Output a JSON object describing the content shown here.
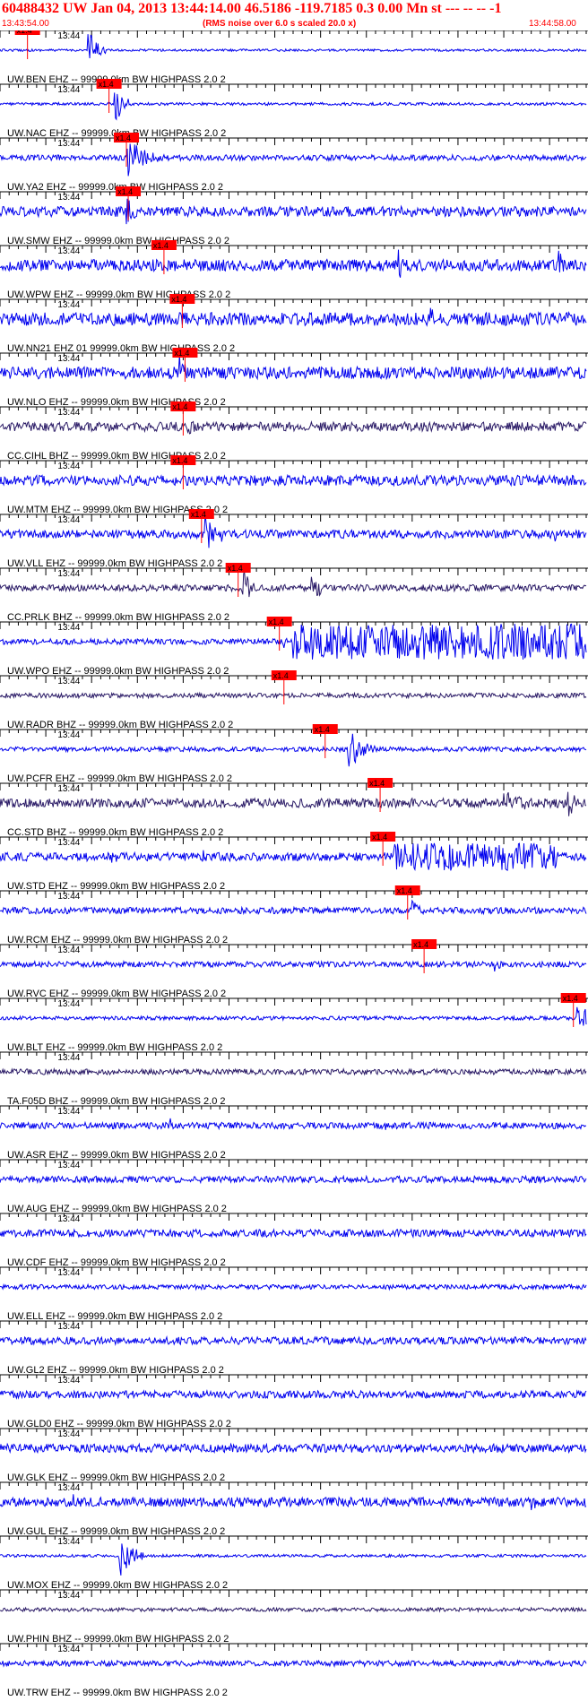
{
  "header": {
    "title": "60488432 UW Jan 04, 2013 13:44:14.00   46.5186 -119.7185  0.3 0.00 Mn st --- -- --   -1",
    "start_time": "13:43:54.00",
    "noise_note": "(RMS noise over 6.0 s scaled 20.0 x)",
    "end_time": "13:44:58.00"
  },
  "colors": {
    "header_red": "#ff0000",
    "trace_blue": "#0000ee",
    "trace_dark": "#2a1a66",
    "pick_red": "#ff0000",
    "axis": "#000000"
  },
  "chart_data": {
    "type": "line",
    "title": "60488432 UW Jan 04, 2013 13:44:14.00",
    "xlabel": "",
    "ylabel": "",
    "xlim": [
      "13:43:54.00",
      "13:44:58.00"
    ],
    "time_tick_label": "13:44",
    "pick_label": "x1.4",
    "traces": [
      {
        "label": "UW.BEN EHZ -- 99999.0km BW  HIGHPASS  2.0  2",
        "pick_s": 3.0,
        "amp": 0.05,
        "color": "blue",
        "events": [
          {
            "t": 9.6,
            "a": 0.95,
            "d": 2
          }
        ]
      },
      {
        "label": "UW.NAC EHZ -- 99999.0km BW  HIGHPASS  2.0  2",
        "pick_s": 11.9,
        "amp": 0.06,
        "color": "blue",
        "events": [
          {
            "t": 12.5,
            "a": 1.0,
            "d": 2
          }
        ]
      },
      {
        "label": "UW.YA2 EHZ -- 99999.0km BW  HIGHPASS  2.0  2",
        "pick_s": 13.8,
        "amp": 0.12,
        "color": "blue",
        "events": [
          {
            "t": 13.9,
            "a": 0.9,
            "d": 4
          }
        ]
      },
      {
        "label": "UW.SMW EHZ -- 99999.0km BW  HIGHPASS  2.0  2",
        "pick_s": 14.0,
        "amp": 0.22,
        "color": "blue",
        "events": [
          {
            "t": 13.8,
            "a": 0.6,
            "d": 3
          }
        ]
      },
      {
        "label": "UW.WPW EHZ -- 99999.0km BW  HIGHPASS  2.0  2",
        "pick_s": 17.9,
        "amp": 0.25,
        "color": "blue",
        "events": [
          {
            "t": 43.5,
            "a": 0.9,
            "d": 1
          },
          {
            "t": 61.0,
            "a": 0.8,
            "d": 1
          }
        ]
      },
      {
        "label": "UW.NN21 EHZ 01 99999.0km BW  HIGHPASS  2.0  2",
        "pick_s": 19.9,
        "amp": 0.28,
        "color": "blue",
        "events": [
          {
            "t": 47.0,
            "a": 0.5,
            "d": 3
          }
        ]
      },
      {
        "label": "UW.NLO EHZ -- 99999.0km BW  HIGHPASS  2.0  2",
        "pick_s": 20.2,
        "amp": 0.26,
        "color": "blue",
        "events": [
          {
            "t": 19.5,
            "a": 0.9,
            "d": 2
          }
        ]
      },
      {
        "label": "CC.CIHL BHZ -- 99999.0km BW  HIGHPASS  2.0  2",
        "pick_s": 20.0,
        "amp": 0.2,
        "color": "dark",
        "events": [
          {
            "t": 20.5,
            "a": 0.4,
            "d": 3
          }
        ]
      },
      {
        "label": "UW.MTM EHZ -- 99999.0km BW  HIGHPASS  2.0  2",
        "pick_s": 20.0,
        "amp": 0.22,
        "color": "blue",
        "events": []
      },
      {
        "label": "UW.VLL EHZ -- 99999.0km BW  HIGHPASS  2.0  2",
        "pick_s": 22.0,
        "amp": 0.18,
        "color": "blue",
        "events": [
          {
            "t": 22.4,
            "a": 0.9,
            "d": 2
          },
          {
            "t": 24.0,
            "a": 0.5,
            "d": 1
          },
          {
            "t": 60.5,
            "a": 0.5,
            "d": 1
          }
        ]
      },
      {
        "label": "CC.PRLK BHZ -- 99999.0km BW  HIGHPASS  2.0  2",
        "pick_s": 26.0,
        "amp": 0.14,
        "color": "dark",
        "events": [
          {
            "t": 26.5,
            "a": 0.8,
            "d": 2
          },
          {
            "t": 34.0,
            "a": 0.9,
            "d": 2
          }
        ]
      },
      {
        "label": "UW.WPO EHZ -- 99999.0km BW  HIGHPASS  2.0  2",
        "pick_s": 30.5,
        "amp": 0.12,
        "color": "blue",
        "events": [
          {
            "t": 31.0,
            "a": 0.5,
            "d": 1
          },
          {
            "t": 32.0,
            "a": 0.9,
            "d": 34
          }
        ]
      },
      {
        "label": "UW.RADR BHZ -- 99999.0km BW  HIGHPASS  2.0  2",
        "pick_s": 31.0,
        "amp": 0.1,
        "color": "dark",
        "events": []
      },
      {
        "label": "UW.PCFR EHZ -- 99999.0km BW  HIGHPASS  2.0  2",
        "pick_s": 35.5,
        "amp": 0.1,
        "color": "blue",
        "events": [
          {
            "t": 38.0,
            "a": 1.0,
            "d": 3
          }
        ]
      },
      {
        "label": "CC.STD BHZ -- 99999.0km BW  HIGHPASS  2.0  2",
        "pick_s": 41.5,
        "amp": 0.2,
        "color": "dark",
        "events": [
          {
            "t": 55.0,
            "a": 0.6,
            "d": 6
          },
          {
            "t": 62.0,
            "a": 0.7,
            "d": 2
          }
        ]
      },
      {
        "label": "UW.STD EHZ -- 99999.0km BW  HIGHPASS  2.0  2",
        "pick_s": 41.8,
        "amp": 0.18,
        "color": "blue",
        "events": [
          {
            "t": 12.0,
            "a": 0.5,
            "d": 2
          },
          {
            "t": 22.0,
            "a": 0.4,
            "d": 2
          },
          {
            "t": 43.0,
            "a": 0.7,
            "d": 18
          }
        ]
      },
      {
        "label": "UW.RCM EHZ -- 99999.0km BW  HIGHPASS  2.0  2",
        "pick_s": 44.5,
        "amp": 0.14,
        "color": "blue",
        "events": [
          {
            "t": 45.0,
            "a": 0.6,
            "d": 1.5
          }
        ]
      },
      {
        "label": "UW.RVC EHZ -- 99999.0km BW  HIGHPASS  2.0  2",
        "pick_s": 46.3,
        "amp": 0.12,
        "color": "blue",
        "events": [
          {
            "t": 54.0,
            "a": 0.4,
            "d": 2
          }
        ]
      },
      {
        "label": "UW.BLT EHZ -- 99999.0km BW  HIGHPASS  2.0  2",
        "pick_s": 62.6,
        "amp": 0.08,
        "color": "blue",
        "events": [
          {
            "t": 63.0,
            "a": 1.0,
            "d": 2
          }
        ]
      },
      {
        "label": "TA.F05D BHZ -- 99999.0km BW  HIGHPASS  2.0  2",
        "pick_s": null,
        "amp": 0.12,
        "color": "dark",
        "events": []
      },
      {
        "label": "UW.ASR EHZ -- 99999.0km BW  HIGHPASS  2.0  2",
        "pick_s": null,
        "amp": 0.14,
        "color": "blue",
        "events": [
          {
            "t": 18.5,
            "a": 0.4,
            "d": 1
          },
          {
            "t": 42.0,
            "a": 0.3,
            "d": 1
          }
        ]
      },
      {
        "label": "UW.AUG EHZ -- 99999.0km BW  HIGHPASS  2.0  2",
        "pick_s": null,
        "amp": 0.14,
        "color": "blue",
        "events": []
      },
      {
        "label": "UW.CDF EHZ -- 99999.0km BW  HIGHPASS  2.0  2",
        "pick_s": null,
        "amp": 0.16,
        "color": "blue",
        "events": []
      },
      {
        "label": "UW.ELL EHZ -- 99999.0km BW  HIGHPASS  2.0  2",
        "pick_s": null,
        "amp": 0.1,
        "color": "blue",
        "events": []
      },
      {
        "label": "UW.GL2 EHZ -- 99999.0km BW  HIGHPASS  2.0  2",
        "pick_s": null,
        "amp": 0.16,
        "color": "blue",
        "events": []
      },
      {
        "label": "UW.GLD0 EHZ -- 99999.0km BW  HIGHPASS  2.0  2",
        "pick_s": null,
        "amp": 0.16,
        "color": "blue",
        "events": []
      },
      {
        "label": "UW.GLK EHZ -- 99999.0km BW  HIGHPASS  2.0  2",
        "pick_s": null,
        "amp": 0.18,
        "color": "blue",
        "events": []
      },
      {
        "label": "UW.GUL EHZ -- 99999.0km BW  HIGHPASS  2.0  2",
        "pick_s": null,
        "amp": 0.2,
        "color": "blue",
        "events": [
          {
            "t": 8.0,
            "a": 0.4,
            "d": 1
          },
          {
            "t": 58.0,
            "a": 0.6,
            "d": 1
          }
        ]
      },
      {
        "label": "UW.MOX EHZ -- 99999.0km BW  HIGHPASS  2.0  2",
        "pick_s": null,
        "amp": 0.06,
        "color": "blue",
        "events": [
          {
            "t": 13.0,
            "a": 1.0,
            "d": 3
          }
        ]
      },
      {
        "label": "UW.PHIN BHZ -- 99999.0km BW  HIGHPASS  2.0  2",
        "pick_s": null,
        "amp": 0.08,
        "color": "dark",
        "events": []
      },
      {
        "label": "UW.TRW EHZ -- 99999.0km BW  HIGHPASS  2.0  2",
        "pick_s": null,
        "amp": 0.12,
        "color": "blue",
        "events": []
      }
    ]
  }
}
